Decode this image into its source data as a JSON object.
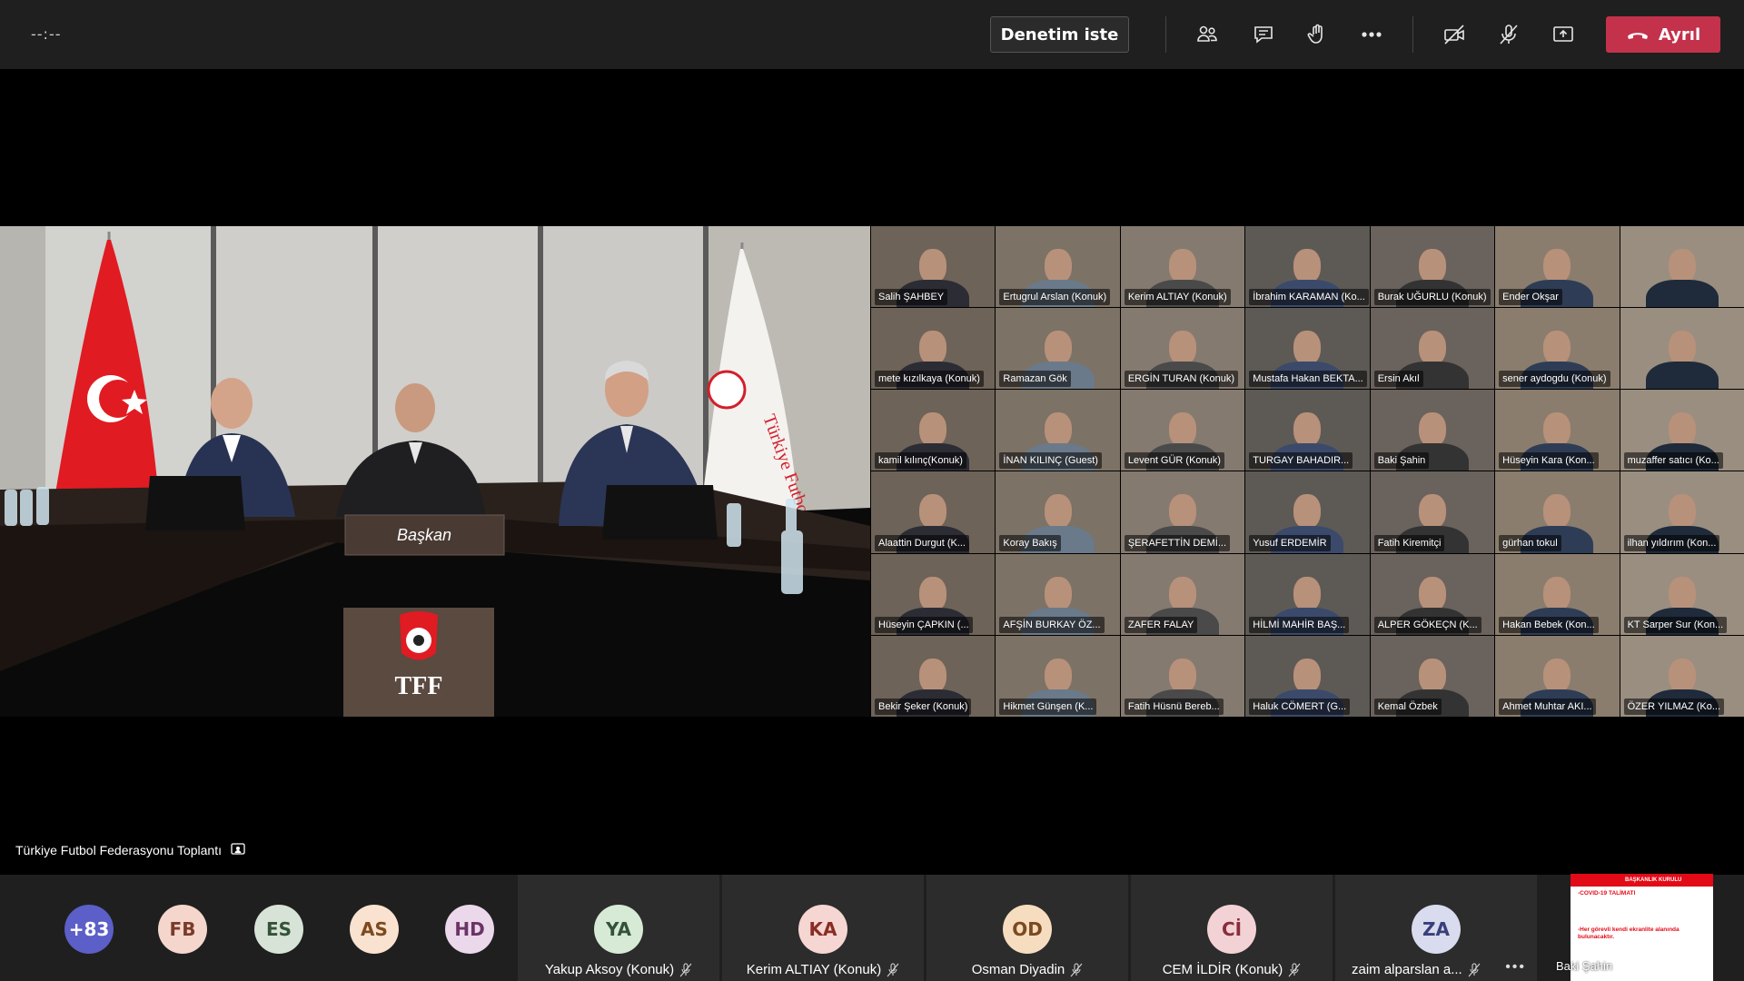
{
  "topbar": {
    "timer": "--:--",
    "request_control_label": "Denetim iste",
    "leave_label": "Ayrıl",
    "icons": [
      "participants-icon",
      "chat-icon",
      "raise-hand-icon",
      "more-icon",
      "camera-off-icon",
      "mic-off-icon",
      "share-icon",
      "hangup-icon"
    ],
    "leave_color": "#c4314b"
  },
  "room": {
    "nameplate": "Başkan",
    "logo_text": "TFF",
    "flag_text": "Türkiye Futbol Federasyonu"
  },
  "grid_participants": [
    "Salih ŞAHBEY",
    "Ertugrul Arslan (Konuk)",
    "Kerim ALTIAY (Konuk)",
    "İbrahim KARAMAN (Ko...",
    "Burak UĞURLU (Konuk)",
    "Ender Okşar",
    "",
    "mete kızılkaya (Konuk)",
    "Ramazan Gök",
    "ERGİN TURAN (Konuk)",
    "Mustafa Hakan BEKTA...",
    "Ersin Akıl",
    "sener aydogdu (Konuk)",
    "",
    "kamil kılınç(Konuk)",
    "İNAN KILINÇ (Guest)",
    "Levent GÜR (Konuk)",
    "TURGAY BAHADIR...",
    "Baki Şahin",
    "Hüseyin Kara (Kon...",
    "muzaffer satıcı (Ko...",
    "Alaattin Durgut (K...",
    "Koray Bakış",
    "ŞERAFETTİN DEMİ...",
    "Yusuf ERDEMİR",
    "Fatih Kiremitçi",
    "gürhan tokul",
    "ilhan yıldırım (Kon...",
    "Hüseyin ÇAPKIN (...",
    "AFŞİN BURKAY ÖZ...",
    "ZAFER FALAY",
    "HİLMİ MAHİR BAŞ...",
    "ALPER GÖKEÇN (K...",
    "Hakan Bebek (Kon...",
    "KT Sarper Sur (Kon...",
    "Bekir Şeker (Konuk)",
    "Hikmet Günşen (K...",
    "Fatih Hüsnü Bereb...",
    "Haluk CÖMERT (G...",
    "Kemal Özbek",
    "Ahmet Muhtar AKI...",
    "ÖZER YILMAZ (Ko..."
  ],
  "meeting_title": "Türkiye Futbol Federasyonu Toplantı",
  "bottom": {
    "overflow_count": "+83",
    "avatars": [
      {
        "initials": "FB",
        "color": "#f4d6cd",
        "text_color": "#7a3a2a"
      },
      {
        "initials": "ES",
        "color": "#d7e3d6",
        "text_color": "#34523a"
      },
      {
        "initials": "AS",
        "color": "#f9e2cf",
        "text_color": "#7c4a1e"
      },
      {
        "initials": "HD",
        "color": "#ebd8ea",
        "text_color": "#6a3466"
      }
    ],
    "participants": [
      {
        "initials": "YA",
        "name": "Yakup Aksoy (Konuk)",
        "color": "#d6ead6",
        "text_color": "#34523a"
      },
      {
        "initials": "KA",
        "name": "Kerim ALTIAY (Konuk)",
        "color": "#f6d6d2",
        "text_color": "#8a2d24"
      },
      {
        "initials": "OD",
        "name": "Osman Diyadin",
        "color": "#f6ddc0",
        "text_color": "#7c4a1e"
      },
      {
        "initials": "Cİ",
        "name": "CEM İLDİR (Konuk)",
        "color": "#f3d2d6",
        "text_color": "#8a2d3a"
      },
      {
        "initials": "ZA",
        "name": "zaim alparslan a...",
        "color": "#d9dbee",
        "text_color": "#37407a"
      }
    ],
    "overflow_color": "#5b5fc7",
    "more_dots": "•••",
    "share": {
      "header": "BAŞKANLIK KURULU",
      "line1": "-COVID-19 TALİMATI",
      "line2": "-Her görevli kendi ekranlite alanında bulunacaktır.",
      "presenter": "Baki Şahin"
    }
  }
}
